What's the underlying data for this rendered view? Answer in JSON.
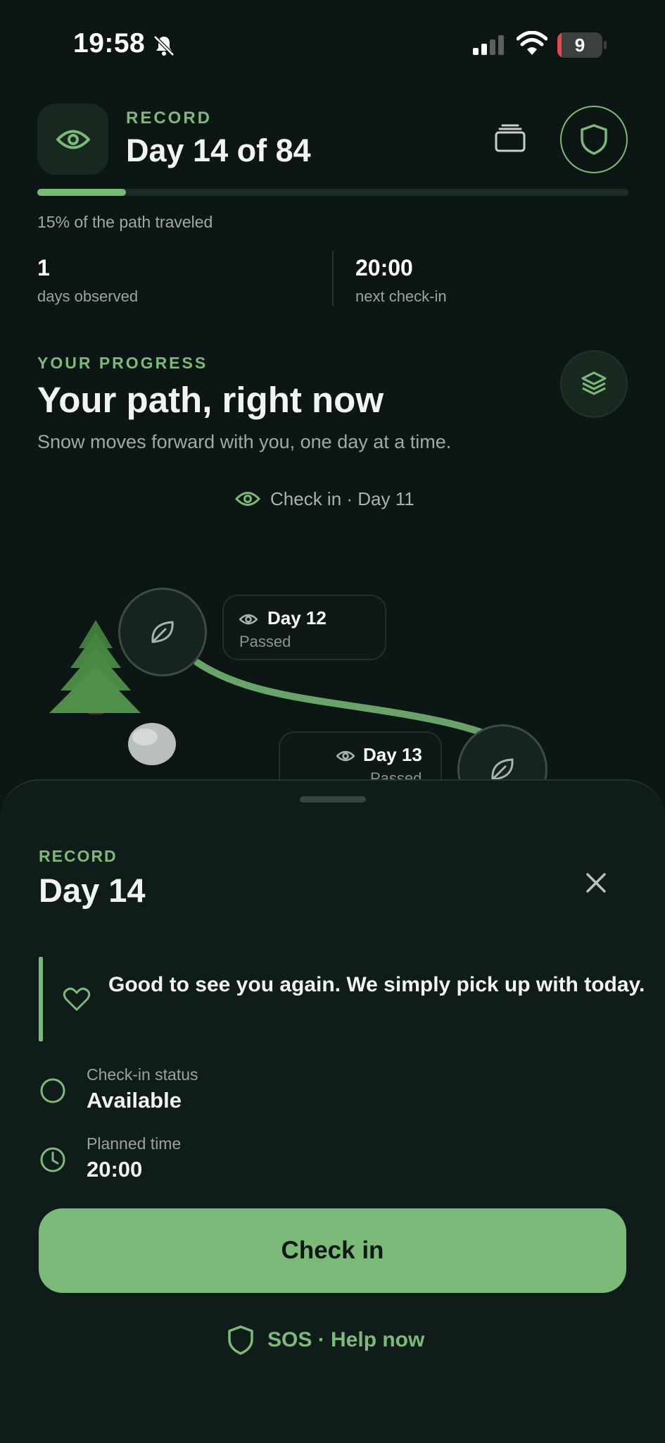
{
  "status_bar": {
    "time": "19:58",
    "battery_level": "9",
    "battery_fraction": 0.09,
    "icons": [
      "bell-slash-icon",
      "cellular-signal-icon",
      "wifi-icon",
      "battery-icon"
    ]
  },
  "header": {
    "kicker": "RECORD",
    "title": "Day 14 of 84",
    "progress_fraction": 0.15,
    "progress_caption": "15% of the path traveled",
    "icons": [
      "eye-icon",
      "cards-icon",
      "shield-icon"
    ]
  },
  "stats": [
    {
      "value": "1",
      "label": "days observed"
    },
    {
      "value": "20:00",
      "label": "next check-in"
    }
  ],
  "progress_section": {
    "kicker": "YOUR PROGRESS",
    "title": "Your path, right now",
    "subtitle": "Snow moves forward with you, one day at a time.",
    "checkin_pill": "Check in · Day 11"
  },
  "path": {
    "days": [
      {
        "title": "Day 12",
        "status": "Passed"
      },
      {
        "title": "Day 13",
        "status": "Passed"
      }
    ]
  },
  "sheet": {
    "kicker": "RECORD",
    "title": "Day 14",
    "message": "Good to see you again. We simply pick up with today.",
    "rows": [
      {
        "label": "Check-in status",
        "value": "Available"
      },
      {
        "label": "Planned time",
        "value": "20:00"
      }
    ],
    "primary_button": "Check in",
    "sos_link": "SOS · Help now"
  },
  "colors": {
    "background": "#0c1614",
    "accent": "#7cba7a",
    "sheet": "#101c19",
    "battery_low": "#e5484d"
  }
}
